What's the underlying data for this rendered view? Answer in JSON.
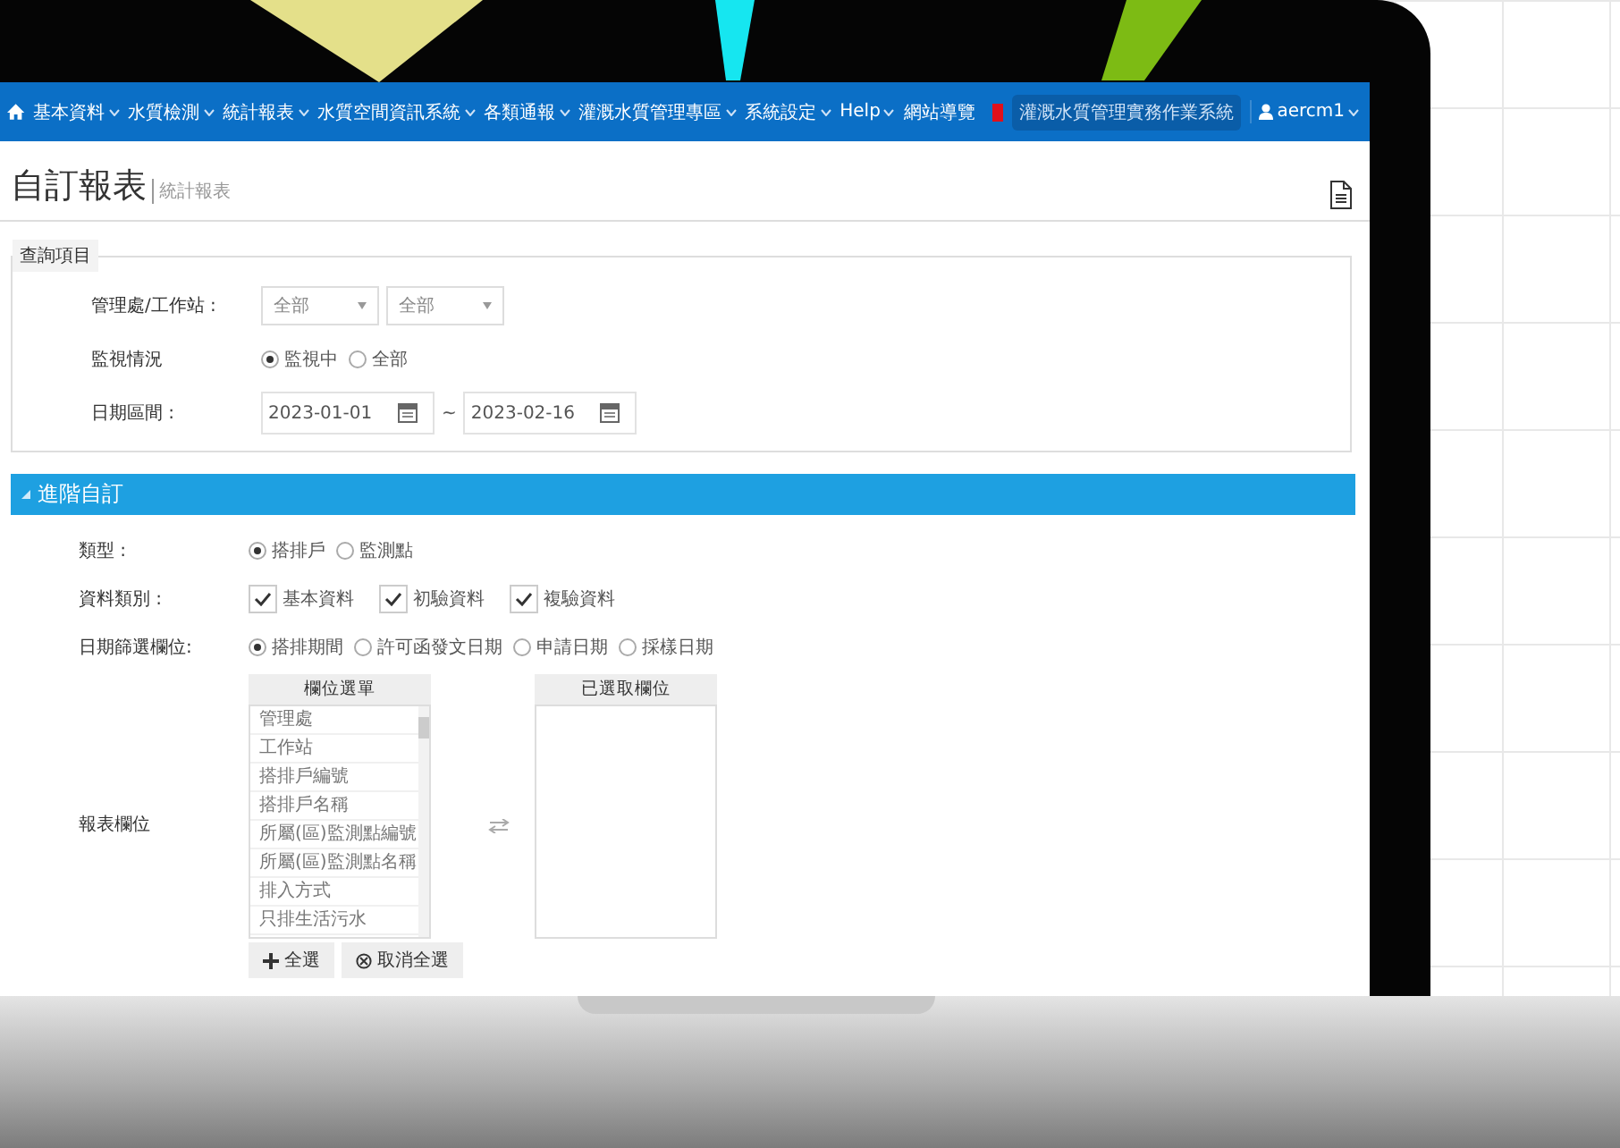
{
  "nav": {
    "items": [
      {
        "label": "基本資料",
        "dropdown": true
      },
      {
        "label": "水質檢測",
        "dropdown": true
      },
      {
        "label": "統計報表",
        "dropdown": true
      },
      {
        "label": "水質空間資訊系統",
        "dropdown": true
      },
      {
        "label": "各類通報",
        "dropdown": true
      },
      {
        "label": "灌溉水質管理專區",
        "dropdown": true
      },
      {
        "label": "系統設定",
        "dropdown": true
      },
      {
        "label": "Help",
        "dropdown": true
      },
      {
        "label": "網站導覽",
        "dropdown": false
      }
    ],
    "notice": "灌溉水質管理實務作業系統",
    "user": "aercm1"
  },
  "page": {
    "title": "自訂報表",
    "breadcrumb": "統計報表"
  },
  "query": {
    "legend": "查詢項目",
    "rows": [
      {
        "kind": "select",
        "label": "管理處/工作站 :",
        "options": [
          {
            "value": "全部"
          },
          {
            "value": "全部"
          }
        ]
      },
      {
        "kind": "radio",
        "label": "監視情況",
        "options": [
          {
            "label": "監視中",
            "selected": true
          },
          {
            "label": "全部",
            "selected": false
          }
        ]
      },
      {
        "kind": "date",
        "label": "日期區間 :",
        "from": "2023-01-01",
        "separator": "~",
        "to": "2023-02-16"
      }
    ]
  },
  "advanced": {
    "title": "進階自訂",
    "expanded": true,
    "rows": [
      {
        "kind": "radio",
        "label": "類型 :",
        "options": [
          {
            "label": "搭排戶",
            "selected": true
          },
          {
            "label": "監測點",
            "selected": false
          }
        ]
      },
      {
        "kind": "checkbox",
        "label": "資料類別 :",
        "options": [
          {
            "label": "基本資料",
            "checked": true
          },
          {
            "label": "初驗資料",
            "checked": true
          },
          {
            "label": "複驗資料",
            "checked": true
          }
        ]
      },
      {
        "kind": "radio",
        "label": "日期篩選欄位:",
        "options": [
          {
            "label": "搭排期間",
            "selected": true
          },
          {
            "label": "許可函發文日期",
            "selected": false
          },
          {
            "label": "申請日期",
            "selected": false
          },
          {
            "label": "採樣日期",
            "selected": false
          }
        ]
      },
      {
        "kind": "duallist",
        "label": "報表欄位",
        "left_header": "欄位選單",
        "left_items": [
          "管理處",
          "工作站",
          "搭排戶編號",
          "搭排戶名稱",
          "所屬(區)監測點編號",
          "所屬(區)監測點名稱",
          "排入方式",
          "只排生活污水"
        ],
        "right_header": "已選取欄位",
        "right_items": [],
        "buttons": [
          {
            "kind": "add",
            "label": "全選"
          },
          {
            "kind": "clear",
            "label": "取消全選"
          }
        ]
      }
    ]
  }
}
